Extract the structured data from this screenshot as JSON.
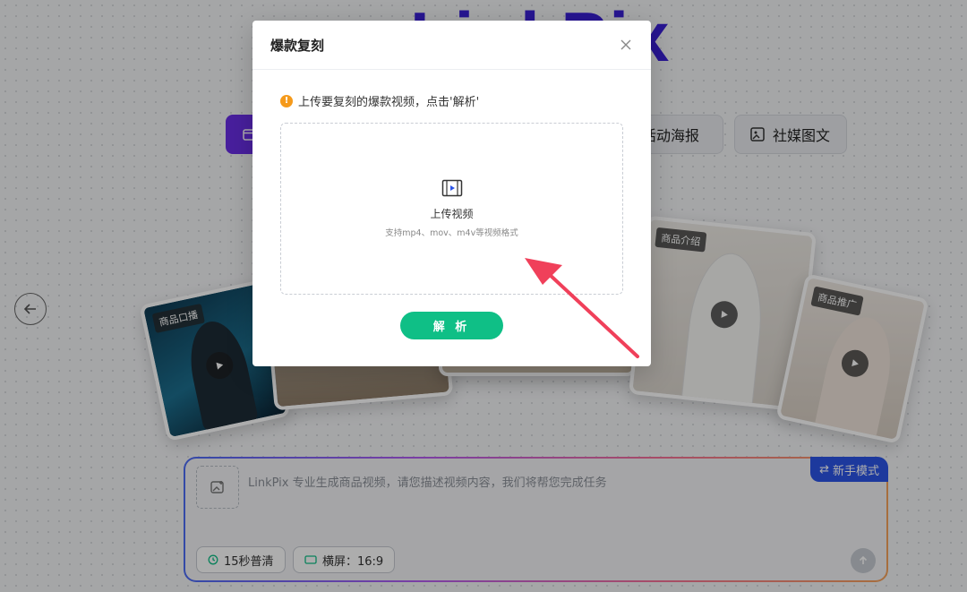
{
  "background": {
    "logo_text": "LinkPix",
    "categories": [
      {
        "label": "",
        "active": true
      },
      {
        "label": "活动海报",
        "active": false
      },
      {
        "label": "社媒图文",
        "active": false
      }
    ],
    "cards": [
      {
        "tag": "商品口播"
      },
      {
        "tag": "商品介绍"
      },
      {
        "tag": "商品推广"
      }
    ],
    "prompt": {
      "placeholder": "LinkPix 专业生成商品视频，请您描述视频内容，我们将帮您完成任务",
      "mode_button": "新手模式",
      "duration_chip": "15秒普清",
      "ratio_chip": "横屏：16:9"
    }
  },
  "modal": {
    "title": "爆款复刻",
    "hint": "上传要复刻的爆款视频，点击'解析'",
    "upload_title": "上传视频",
    "upload_formats": "支持mp4、mov、m4v等视频格式",
    "parse_button": "解 析"
  },
  "colors": {
    "primary_green": "#0fbf86",
    "warning_orange": "#f59a1b",
    "accent_blue": "#2c55e8",
    "annotation_red": "#f0405a"
  }
}
